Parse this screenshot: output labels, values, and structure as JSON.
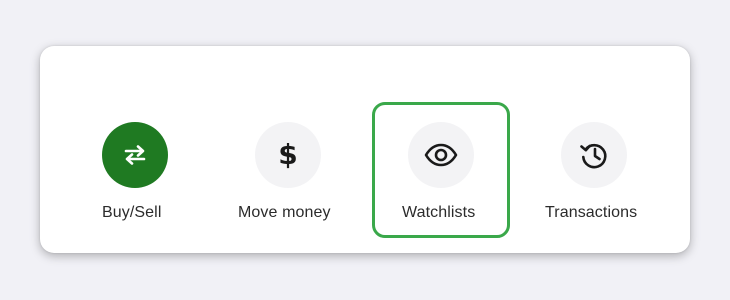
{
  "quick_actions": {
    "items": [
      {
        "label": "Buy/Sell",
        "icon": "swap-arrows-icon",
        "style": "primary"
      },
      {
        "label": "Move money",
        "icon": "dollar-icon",
        "style": "default"
      },
      {
        "label": "Watchlists",
        "icon": "eye-icon",
        "style": "default",
        "focused": true
      },
      {
        "label": "Transactions",
        "icon": "history-icon",
        "style": "default"
      }
    ],
    "dollar_glyph": "$"
  },
  "colors": {
    "primary": "#1f7a22",
    "focus_ring": "#3aa84a",
    "icon_bg": "#f3f3f5"
  }
}
